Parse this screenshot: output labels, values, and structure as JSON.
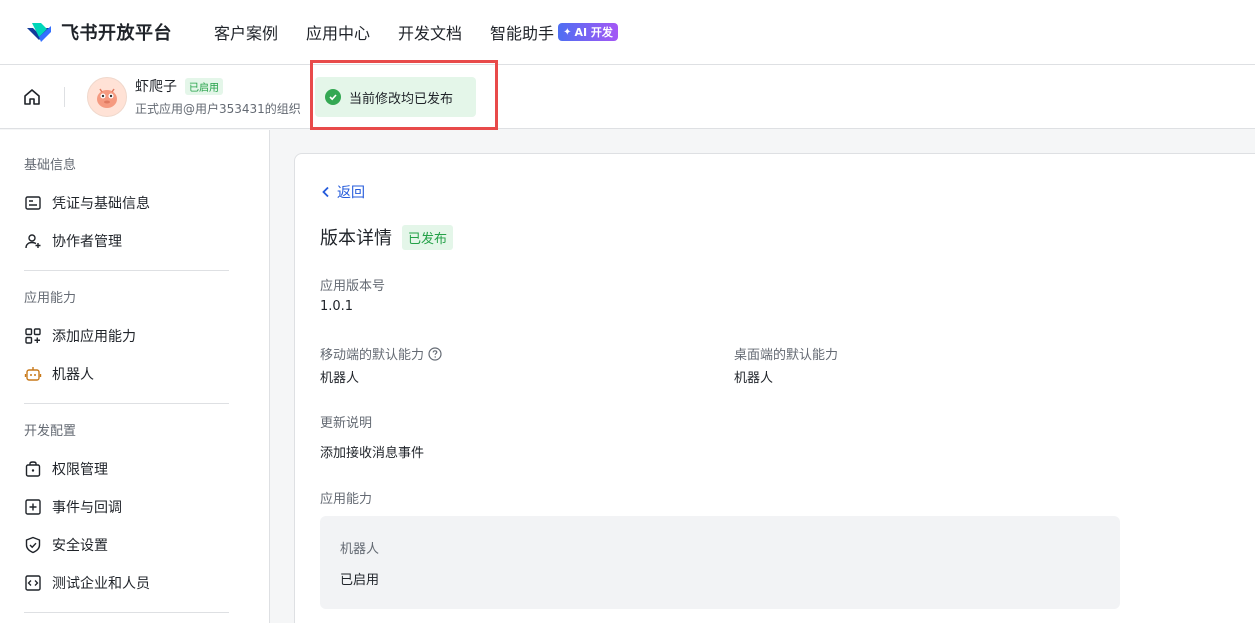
{
  "nav": {
    "logo_text": "飞书开放平台",
    "links": [
      "客户案例",
      "应用中心",
      "开发文档",
      "智能助手"
    ],
    "ai_badge": "AI 开发"
  },
  "app": {
    "name": "虾爬子",
    "status": "已启用",
    "org": "正式应用@用户353431的组织"
  },
  "toast": {
    "message": "当前修改均已发布"
  },
  "sidebar": {
    "sections": [
      {
        "title": "基础信息",
        "items": [
          {
            "label": "凭证与基础信息",
            "icon": "credential-icon"
          },
          {
            "label": "协作者管理",
            "icon": "add-user-icon"
          }
        ]
      },
      {
        "title": "应用能力",
        "items": [
          {
            "label": "添加应用能力",
            "icon": "grid-add-icon"
          },
          {
            "label": "机器人",
            "icon": "robot-icon"
          }
        ]
      },
      {
        "title": "开发配置",
        "items": [
          {
            "label": "权限管理",
            "icon": "lock-icon"
          },
          {
            "label": "事件与回调",
            "icon": "event-icon"
          },
          {
            "label": "安全设置",
            "icon": "shield-icon"
          },
          {
            "label": "测试企业和人员",
            "icon": "code-icon"
          }
        ]
      }
    ]
  },
  "main": {
    "back_label": "返回",
    "title": "版本详情",
    "status_badge": "已发布",
    "version_label": "应用版本号",
    "version_value": "1.0.1",
    "mobile_label": "移动端的默认能力",
    "mobile_value": "机器人",
    "desktop_label": "桌面端的默认能力",
    "desktop_value": "机器人",
    "notes_label": "更新说明",
    "notes_value": "添加接收消息事件",
    "capabilities_label": "应用能力",
    "capability_name": "机器人",
    "capability_status": "已启用"
  },
  "colors": {
    "accent": "#245bdb",
    "success": "#24a148",
    "highlight": "#e84a4a"
  }
}
